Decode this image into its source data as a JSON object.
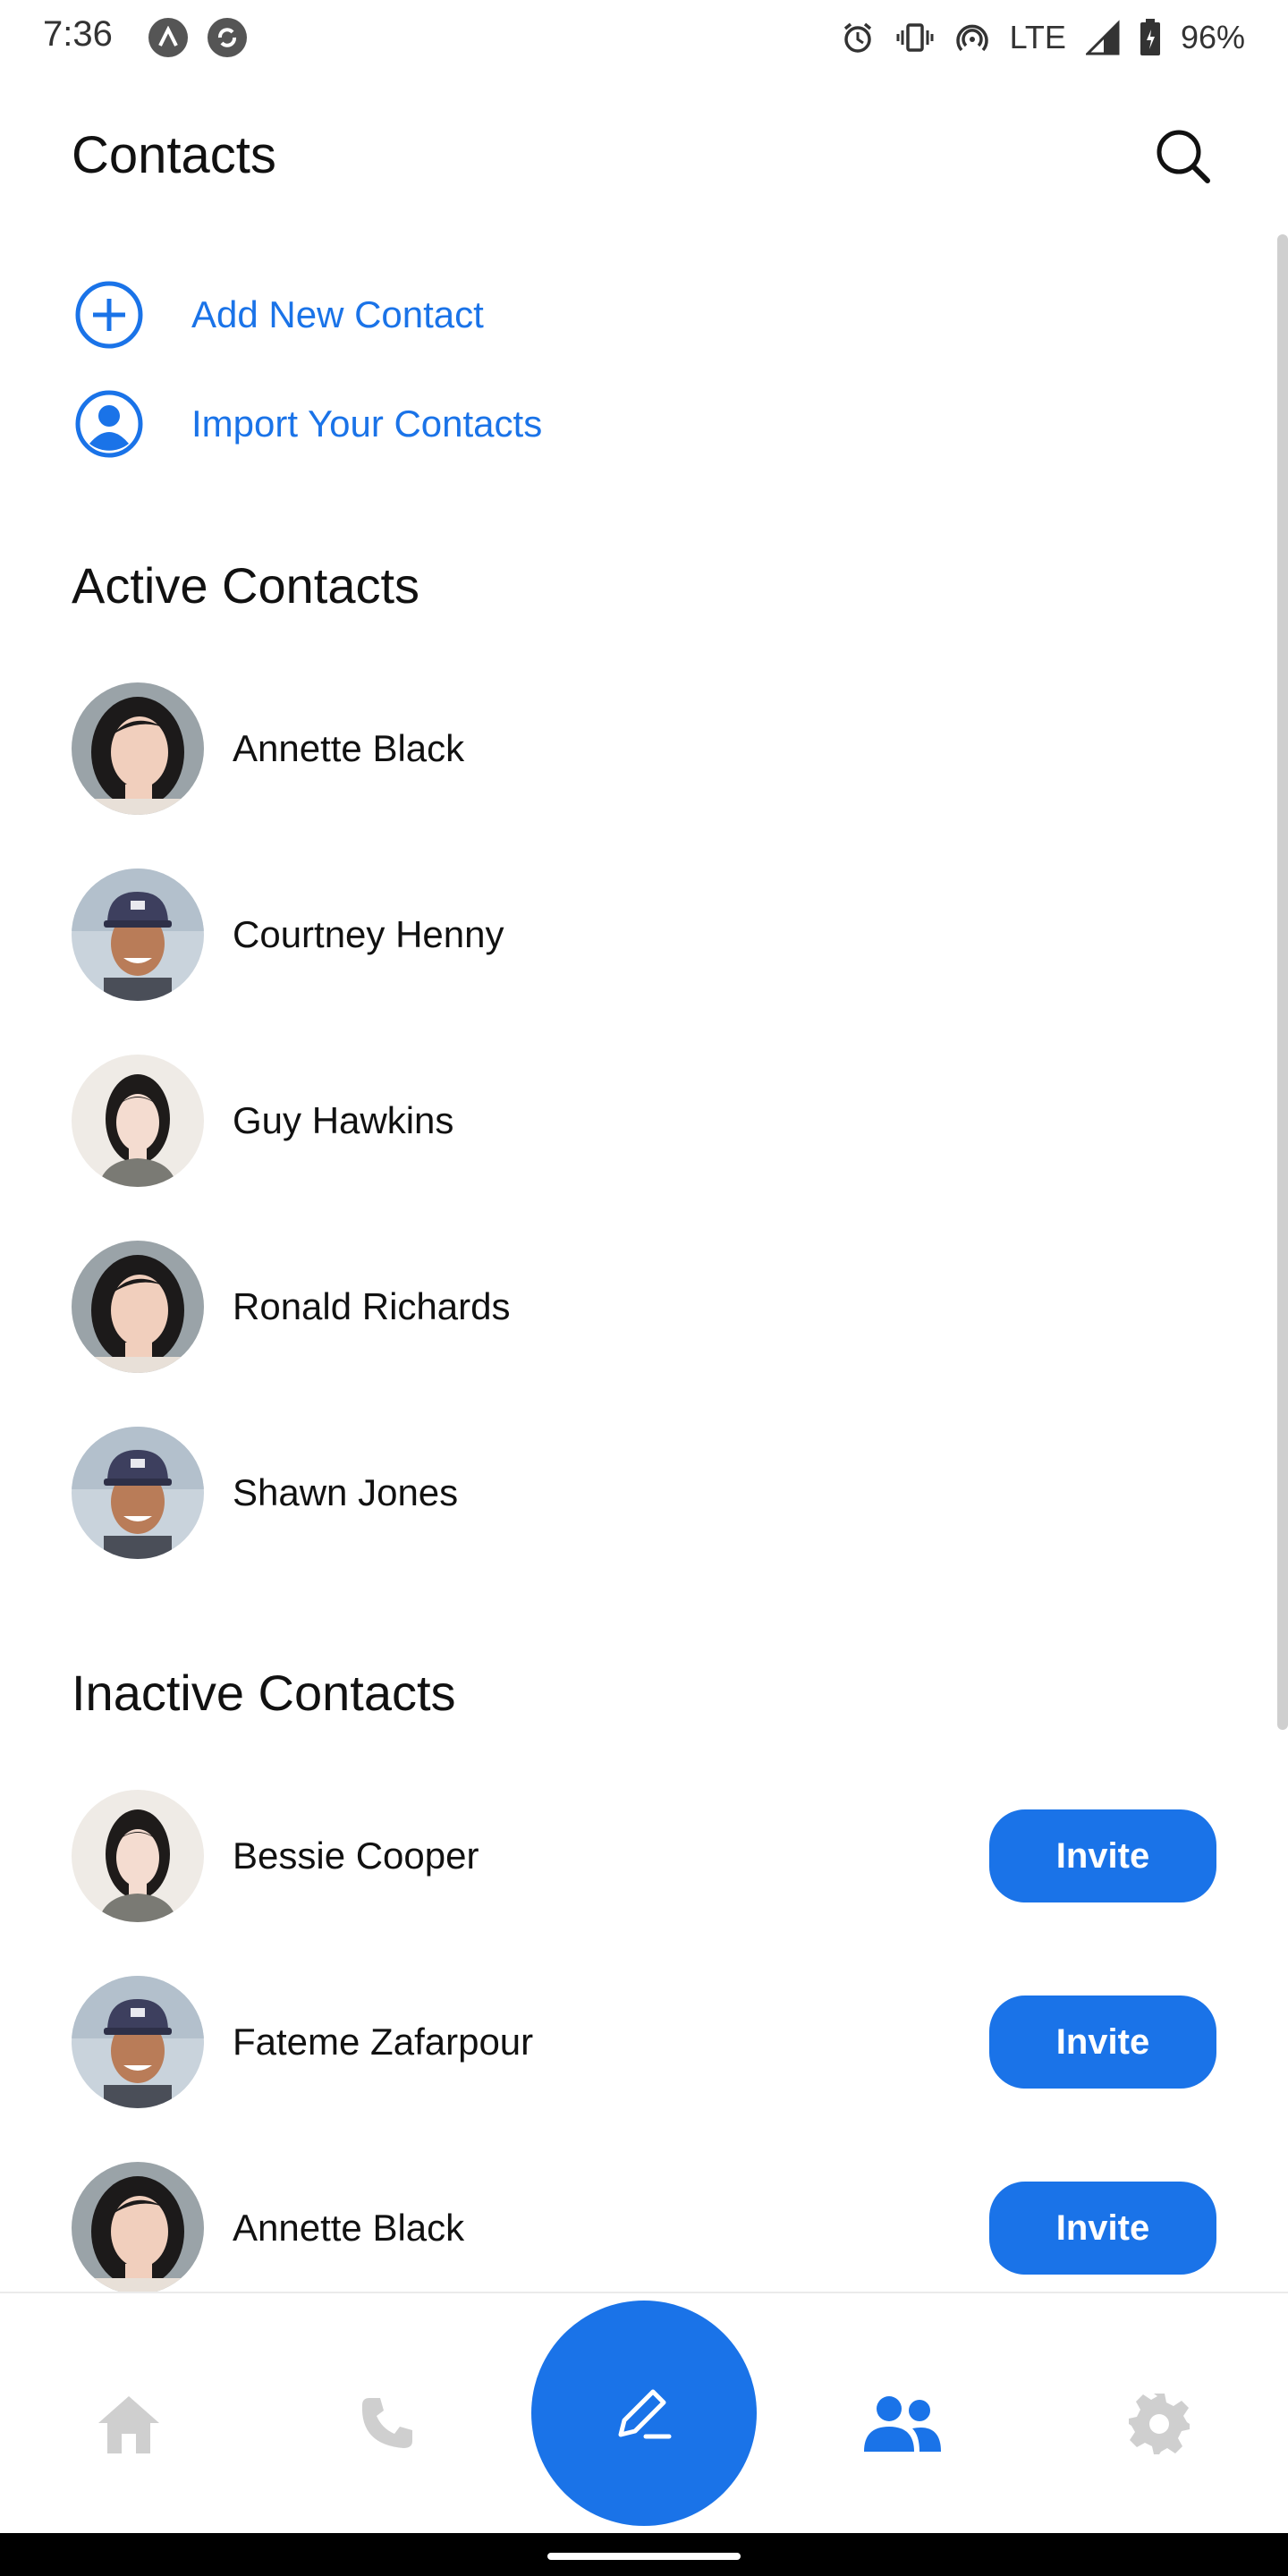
{
  "status_bar": {
    "time": "7:36",
    "network": "LTE",
    "battery": "96%",
    "icons": [
      "alert-a-icon",
      "sync-icon",
      "alarm-icon",
      "vibrate-icon",
      "hotspot-icon",
      "signal-icon",
      "battery-icon"
    ]
  },
  "header": {
    "title": "Contacts",
    "search_icon": "search-icon"
  },
  "actions": [
    {
      "label": "Add New Contact",
      "icon": "add-circle-icon"
    },
    {
      "label": "Import Your Contacts",
      "icon": "account-circle-icon"
    }
  ],
  "active_section": {
    "title": "Active Contacts",
    "contacts": [
      {
        "name": "Annette Black"
      },
      {
        "name": "Courtney Henny"
      },
      {
        "name": "Guy Hawkins"
      },
      {
        "name": "Ronald Richards"
      },
      {
        "name": "Shawn Jones"
      }
    ]
  },
  "inactive_section": {
    "title": "Inactive Contacts",
    "contacts": [
      {
        "name": "Bessie Cooper",
        "action": "Invite"
      },
      {
        "name": "Fateme Zafarpour",
        "action": "Invite"
      },
      {
        "name": "Annette Black",
        "action": "Invite"
      }
    ]
  },
  "bottom_nav": {
    "items": [
      "home-icon",
      "phone-icon",
      "compose-icon",
      "contacts-icon",
      "settings-icon"
    ],
    "active": "contacts-icon"
  },
  "colors": {
    "accent": "#1a73e8",
    "inactive_icon": "#cfcfcf",
    "text": "#111111"
  }
}
